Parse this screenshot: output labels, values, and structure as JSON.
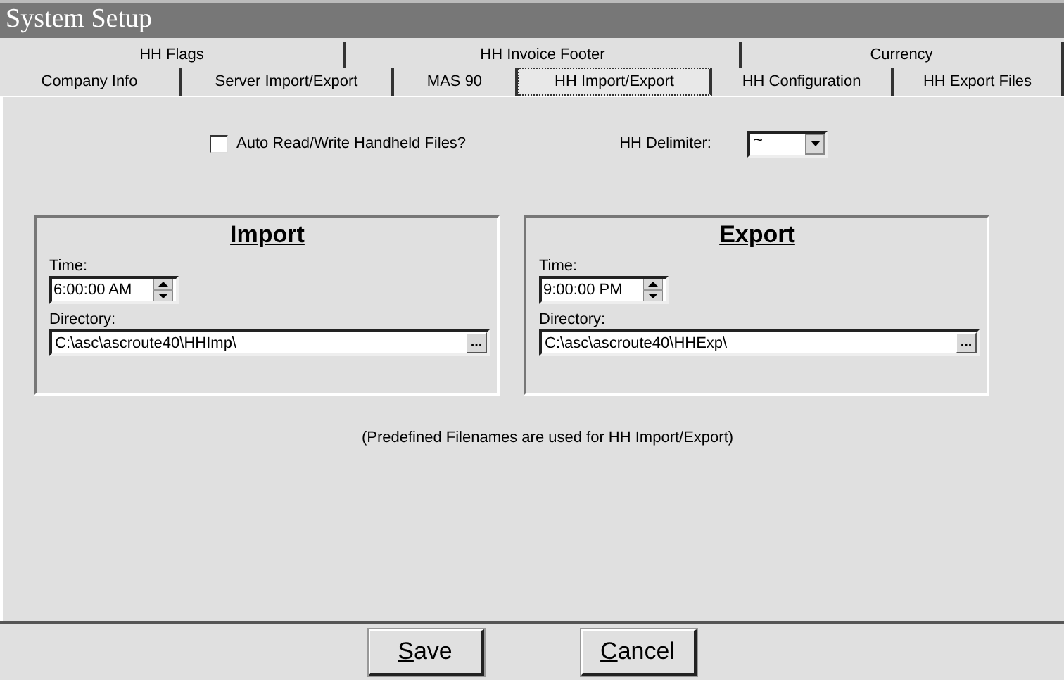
{
  "window": {
    "title": "System Setup"
  },
  "tab_rows": [
    [
      {
        "label": "HH Flags",
        "selected": false
      },
      {
        "label": "HH Invoice Footer",
        "selected": false
      },
      {
        "label": "Currency",
        "selected": false
      }
    ],
    [
      {
        "label": "Company Info",
        "selected": false
      },
      {
        "label": "Server Import/Export",
        "selected": false
      },
      {
        "label": "MAS 90",
        "selected": false
      },
      {
        "label": "HH Import/Export",
        "selected": true
      },
      {
        "label": "HH Configuration",
        "selected": false
      },
      {
        "label": "HH Export Files",
        "selected": false
      }
    ]
  ],
  "auto_checkbox": {
    "label": "Auto Read/Write Handheld Files?",
    "checked": false
  },
  "delimiter": {
    "label": "HH Delimiter:",
    "value": "~"
  },
  "groups": [
    {
      "title": "Import",
      "time_label": "Time:",
      "time": "6:00:00 AM",
      "dir_label": "Directory:",
      "directory": "C:\\asc\\ascroute40\\HHImp\\",
      "browse": "..."
    },
    {
      "title": "Export",
      "time_label": "Time:",
      "time": "9:00:00 PM",
      "dir_label": "Directory:",
      "directory": "C:\\asc\\ascroute40\\HHExp\\",
      "browse": "..."
    }
  ],
  "note": "(Predefined  Filenames are used for HH Import/Export)",
  "buttons": [
    "Save",
    "Cancel"
  ]
}
